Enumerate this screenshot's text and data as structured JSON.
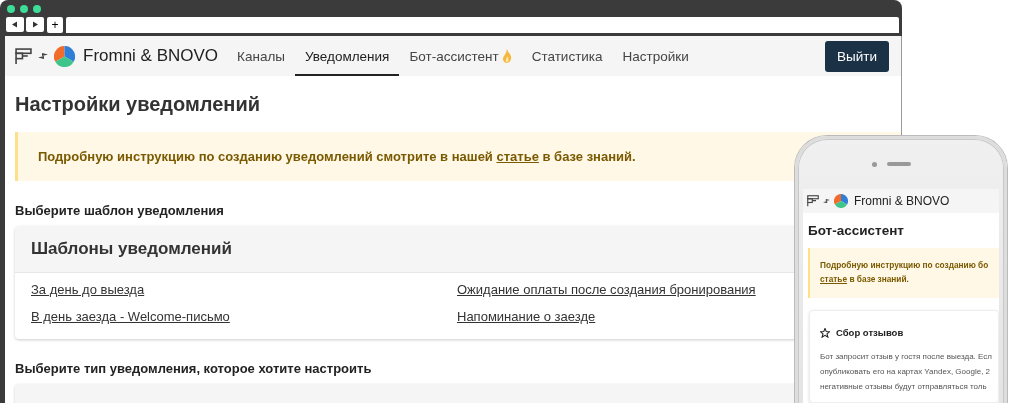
{
  "browser": {
    "new_tab_label": "+"
  },
  "navbar": {
    "brand": "Fromni & BNOVO",
    "tabs": [
      {
        "label": "Каналы",
        "selected": false
      },
      {
        "label": "Уведомления",
        "selected": true
      },
      {
        "label": "Бот-ассистент",
        "selected": false,
        "kind": "with_icon"
      },
      {
        "label": "Статистика",
        "selected": false
      },
      {
        "label": "Настройки",
        "selected": false
      }
    ],
    "logout": "Выйти"
  },
  "page": {
    "title": "Настройки уведомлений",
    "alert": {
      "before": "Подробную инструкцию по созданию уведомлений смотрите в нашей ",
      "link": "статье",
      "after": " в базе знаний."
    },
    "sections": [
      {
        "label": "Выберите шаблон уведомления",
        "card_title": "Шаблоны уведомлений",
        "links": [
          "За день до выезда",
          "Ожидание оплаты после создания бронирования",
          "В день заезда - Welcome-письмо",
          "Напоминание о заезде"
        ]
      },
      {
        "label": "Выберите тип уведомления, которое хотите настроить"
      }
    ]
  },
  "phone": {
    "brand": "Fromni & BNOVO",
    "title": "Бот-ассистент",
    "alert": {
      "line": "Подробную инструкцию по созданию бо",
      "link": "статье",
      "after": " в базе знаний."
    },
    "card": {
      "title": "Сбор отзывов",
      "lines": [
        "Бот запросит отзыв у гостя после выезда. Есл",
        "опубликовать его на картах Yandex, Google, 2",
        "негативные отзывы будут отправляться толь"
      ]
    }
  }
}
